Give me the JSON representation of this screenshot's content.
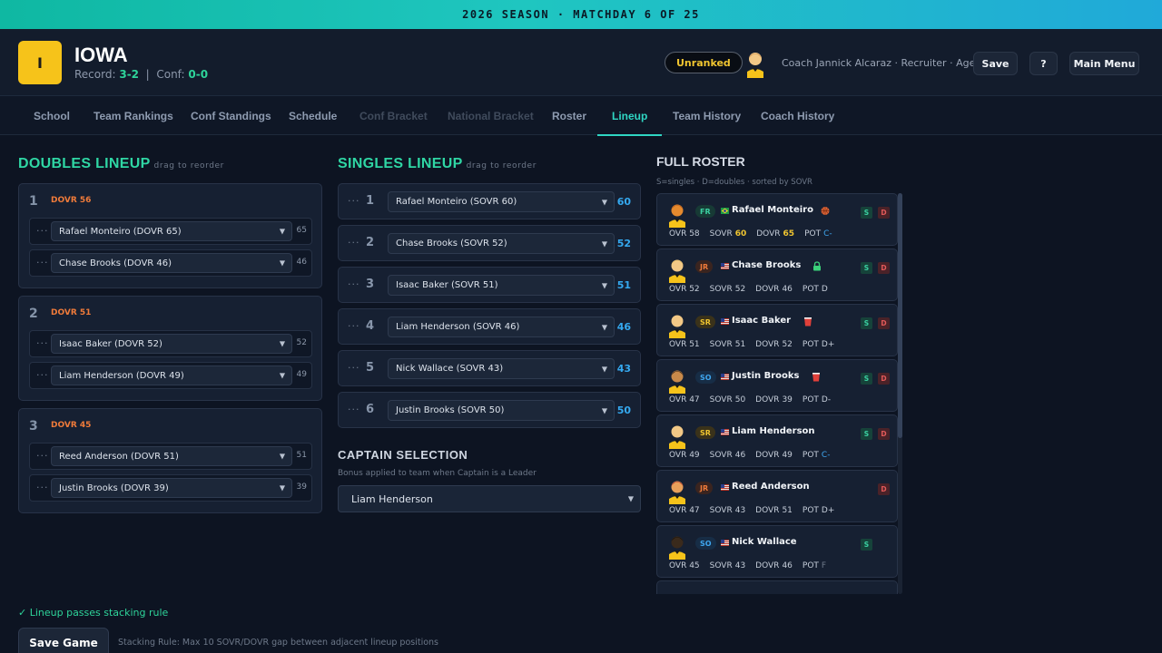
{
  "banner": "2026 SEASON · MATCHDAY 6 OF 25",
  "team": {
    "logo_letter": "I",
    "name": "IOWA",
    "record_label": "Record:",
    "record": "3-2",
    "conf_label": "Conf:",
    "conf": "0-0"
  },
  "header": {
    "rank": "Unranked",
    "coach": "Coach Jannick Alcaraz · Recruiter · Age 25",
    "save_label": "Save",
    "help_label": "?",
    "menu_label": "Main Menu"
  },
  "nav": [
    {
      "label": "School",
      "state": "normal"
    },
    {
      "label": "Team Rankings",
      "state": "normal"
    },
    {
      "label": "Conf Standings",
      "state": "normal"
    },
    {
      "label": "Schedule",
      "state": "normal"
    },
    {
      "label": "Conf Bracket",
      "state": "disabled"
    },
    {
      "label": "National Bracket",
      "state": "disabled"
    },
    {
      "label": "Roster",
      "state": "normal"
    },
    {
      "label": "Lineup",
      "state": "active"
    },
    {
      "label": "Team History",
      "state": "normal"
    },
    {
      "label": "Coach History",
      "state": "normal"
    }
  ],
  "doubles": {
    "title": "DOUBLES LINEUP",
    "hint": "drag to reorder",
    "pairs": [
      {
        "num": "1",
        "dovr": "DOVR 56",
        "players": [
          {
            "name": "Rafael Monteiro (DOVR 65)",
            "val": "65"
          },
          {
            "name": "Chase Brooks (DOVR 46)",
            "val": "46"
          }
        ]
      },
      {
        "num": "2",
        "dovr": "DOVR 51",
        "players": [
          {
            "name": "Isaac Baker (DOVR 52)",
            "val": "52"
          },
          {
            "name": "Liam Henderson (DOVR 49)",
            "val": "49"
          }
        ]
      },
      {
        "num": "3",
        "dovr": "DOVR 45",
        "players": [
          {
            "name": "Reed Anderson (DOVR 51)",
            "val": "51"
          },
          {
            "name": "Justin Brooks (DOVR 39)",
            "val": "39"
          }
        ]
      }
    ]
  },
  "singles": {
    "title": "SINGLES LINEUP",
    "hint": "drag to reorder",
    "rows": [
      {
        "num": "1",
        "name": "Rafael Monteiro (SOVR 60)",
        "val": "60"
      },
      {
        "num": "2",
        "name": "Chase Brooks (SOVR 52)",
        "val": "52"
      },
      {
        "num": "3",
        "name": "Isaac Baker (SOVR 51)",
        "val": "51"
      },
      {
        "num": "4",
        "name": "Liam Henderson (SOVR 46)",
        "val": "46"
      },
      {
        "num": "5",
        "name": "Nick Wallace (SOVR 43)",
        "val": "43"
      },
      {
        "num": "6",
        "name": "Justin Brooks (SOVR 50)",
        "val": "50"
      }
    ]
  },
  "captain": {
    "title": "CAPTAIN SELECTION",
    "subtitle": "Bonus applied to team when Captain is a Leader",
    "selected": "Liam Henderson"
  },
  "roster": {
    "title": "FULL ROSTER",
    "subtitle": "S=singles · D=doubles · sorted by SOVR",
    "players": [
      {
        "year": "FR",
        "flag": "br",
        "name": "Rafael Monteiro",
        "trait": "basketball",
        "s": "S",
        "d": "D",
        "ovr": "OVR 58",
        "sovr": "SOVR",
        "sovr_v": "60",
        "dovr": "DOVR",
        "dovr_v": "65",
        "pot": "POT",
        "pot_v": "C-",
        "hl_s": true,
        "hl_d": true,
        "pot_c": "b",
        "skin": "#e58a2e",
        "hair": "#b8561c"
      },
      {
        "year": "JR",
        "flag": "us",
        "name": "Chase Brooks",
        "trait": "lock",
        "s": "S",
        "d": "D",
        "ovr": "OVR 52",
        "sovr": "SOVR",
        "sovr_v": "52",
        "dovr": "DOVR",
        "dovr_v": "46",
        "pot": "POT",
        "pot_v": "D",
        "hl_s": false,
        "hl_d": false,
        "pot_c": "n",
        "skin": "#f2c886",
        "hair": "#e8c061"
      },
      {
        "year": "SR",
        "flag": "us",
        "name": "Isaac Baker",
        "trait": "cup",
        "s": "S",
        "d": "D",
        "ovr": "OVR 51",
        "sovr": "SOVR",
        "sovr_v": "51",
        "dovr": "DOVR",
        "dovr_v": "52",
        "pot": "POT",
        "pot_v": "D+",
        "hl_s": false,
        "hl_d": false,
        "pot_c": "n",
        "skin": "#f2c886",
        "hair": "#f2c886"
      },
      {
        "year": "SO",
        "flag": "us",
        "name": "Justin Brooks",
        "trait": "cup",
        "s": "S",
        "d": "D",
        "ovr": "OVR 47",
        "sovr": "SOVR",
        "sovr_v": "50",
        "dovr": "DOVR",
        "dovr_v": "39",
        "pot": "POT",
        "pot_v": "D-",
        "hl_s": false,
        "hl_d": false,
        "pot_c": "n",
        "skin": "#c98a4a",
        "hair": "#2a1a10"
      },
      {
        "year": "SR",
        "flag": "us",
        "name": "Liam Henderson",
        "trait": "",
        "s": "S",
        "d": "D",
        "ovr": "OVR 49",
        "sovr": "SOVR",
        "sovr_v": "46",
        "dovr": "DOVR",
        "dovr_v": "49",
        "pot": "POT",
        "pot_v": "C-",
        "hl_s": false,
        "hl_d": false,
        "pot_c": "b",
        "skin": "#f2c886",
        "hair": "#f2c886"
      },
      {
        "year": "JR",
        "flag": "us",
        "name": "Reed Anderson",
        "trait": "",
        "s": "",
        "d": "D",
        "ovr": "OVR 47",
        "sovr": "SOVR",
        "sovr_v": "43",
        "dovr": "DOVR",
        "dovr_v": "51",
        "pot": "POT",
        "pot_v": "D+",
        "hl_s": false,
        "hl_d": false,
        "pot_c": "n",
        "skin": "#e8a05a",
        "hair": "#b12a2a"
      },
      {
        "year": "SO",
        "flag": "us",
        "name": "Nick Wallace",
        "trait": "",
        "s": "S",
        "d": "",
        "ovr": "OVR 45",
        "sovr": "SOVR",
        "sovr_v": "43",
        "dovr": "DOVR",
        "dovr_v": "46",
        "pot": "POT",
        "pot_v": "F",
        "hl_s": false,
        "hl_d": false,
        "pot_c": "d",
        "skin": "#3a2a1c",
        "hair": "#1a120a"
      }
    ]
  },
  "footer": {
    "status": "✓ Lineup passes stacking rule",
    "save_label": "Save Game",
    "rule": "Stacking Rule: Max 10 SOVR/DOVR gap between adjacent lineup positions"
  },
  "colors": {
    "accent": "#2fd6c3",
    "section_green": "#2fd6a4",
    "dovr_orange": "#f07b3a",
    "sovr_blue": "#35a9f0",
    "logo_yellow": "#f6c31a"
  },
  "icons": [
    "coach-avatar-icon",
    "drag-handle-icon",
    "chevron-down-icon",
    "player-avatar-icon",
    "flag-icon",
    "basketball-icon",
    "lock-icon",
    "cup-icon"
  ]
}
